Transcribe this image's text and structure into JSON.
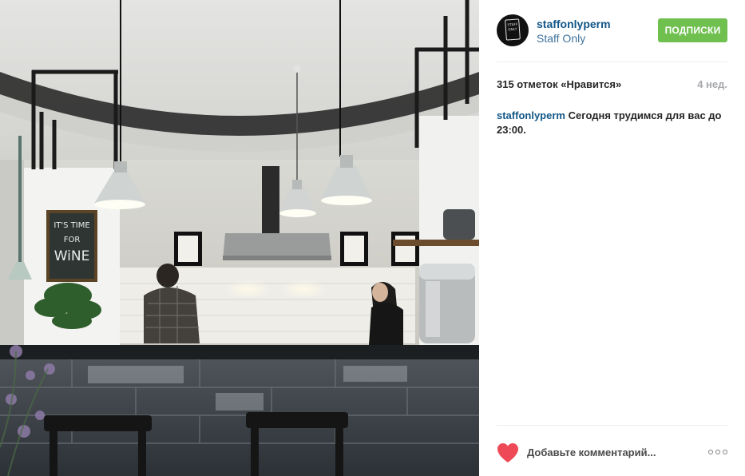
{
  "header": {
    "username": "staffonlyperm",
    "full_name": "Staff Only",
    "follow_label": "Подписки",
    "avatar_text": "STAFF ONLY",
    "follow_color": "#70c050",
    "username_color": "#125688"
  },
  "photo": {
    "sign_line1": "IT'S TIME",
    "sign_line2": "FOR",
    "sign_line3": "WiNE"
  },
  "stats": {
    "likes": "315 отметок «Нравится»",
    "time_ago": "4 нед."
  },
  "caption": {
    "username": "staffonlyperm",
    "text": "Сегодня трудимся для вас до 23:00."
  },
  "comment": {
    "placeholder": "Добавьте комментарий...",
    "heart_icon": "heart-icon",
    "heart_color": "#ed4956",
    "more_icon": "more-options-icon"
  }
}
